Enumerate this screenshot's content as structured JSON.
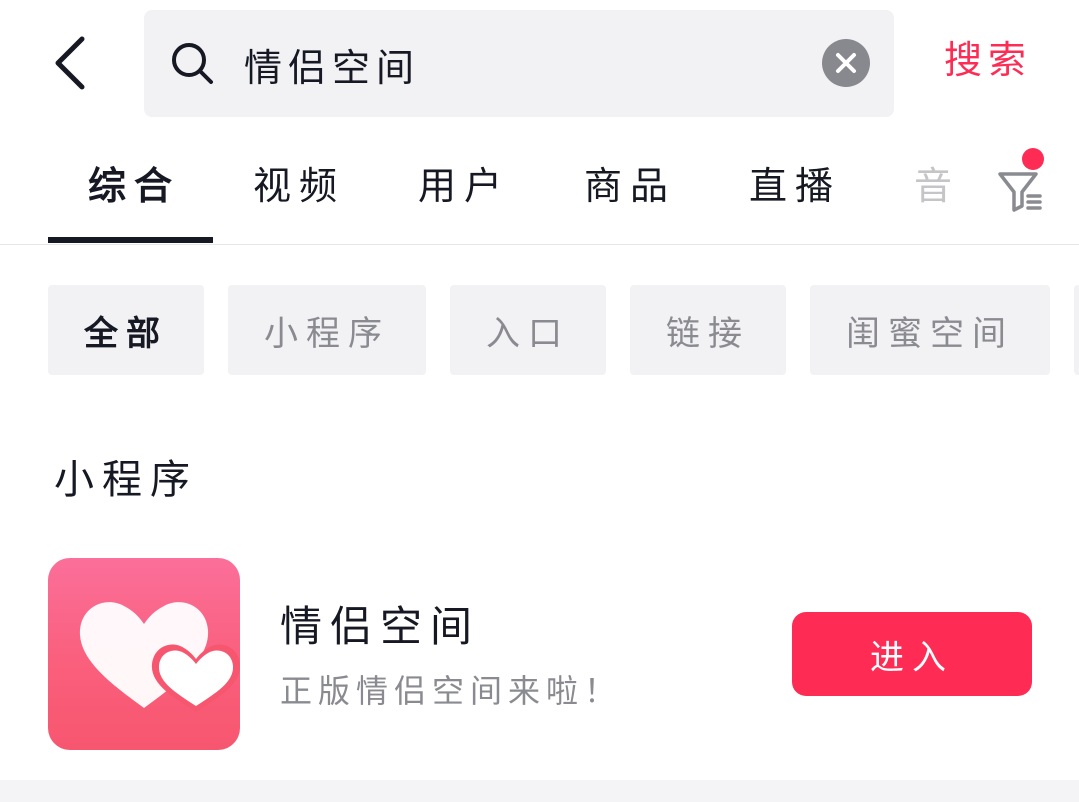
{
  "header": {
    "back_icon": "chevron-left-icon",
    "search_icon": "search-icon",
    "search_query": "情侣空间",
    "clear_icon": "close-circle-icon",
    "search_button_label": "搜索",
    "accent_color": "#fe2c55"
  },
  "tabs": [
    {
      "label": "综合",
      "active": true
    },
    {
      "label": "视频"
    },
    {
      "label": "用户"
    },
    {
      "label": "商品"
    },
    {
      "label": "直播"
    },
    {
      "label": "音"
    }
  ],
  "filter": {
    "icon": "filter-icon",
    "has_badge": true
  },
  "chips": [
    {
      "label": "全部",
      "active": true
    },
    {
      "label": "小程序"
    },
    {
      "label": "入口"
    },
    {
      "label": "链接"
    },
    {
      "label": "闺蜜空间"
    }
  ],
  "section": {
    "title": "小程序"
  },
  "mini_program": {
    "icon": "double-heart-icon",
    "name": "情侣空间",
    "description": "正版情侣空间来啦！",
    "action_label": "进入"
  }
}
